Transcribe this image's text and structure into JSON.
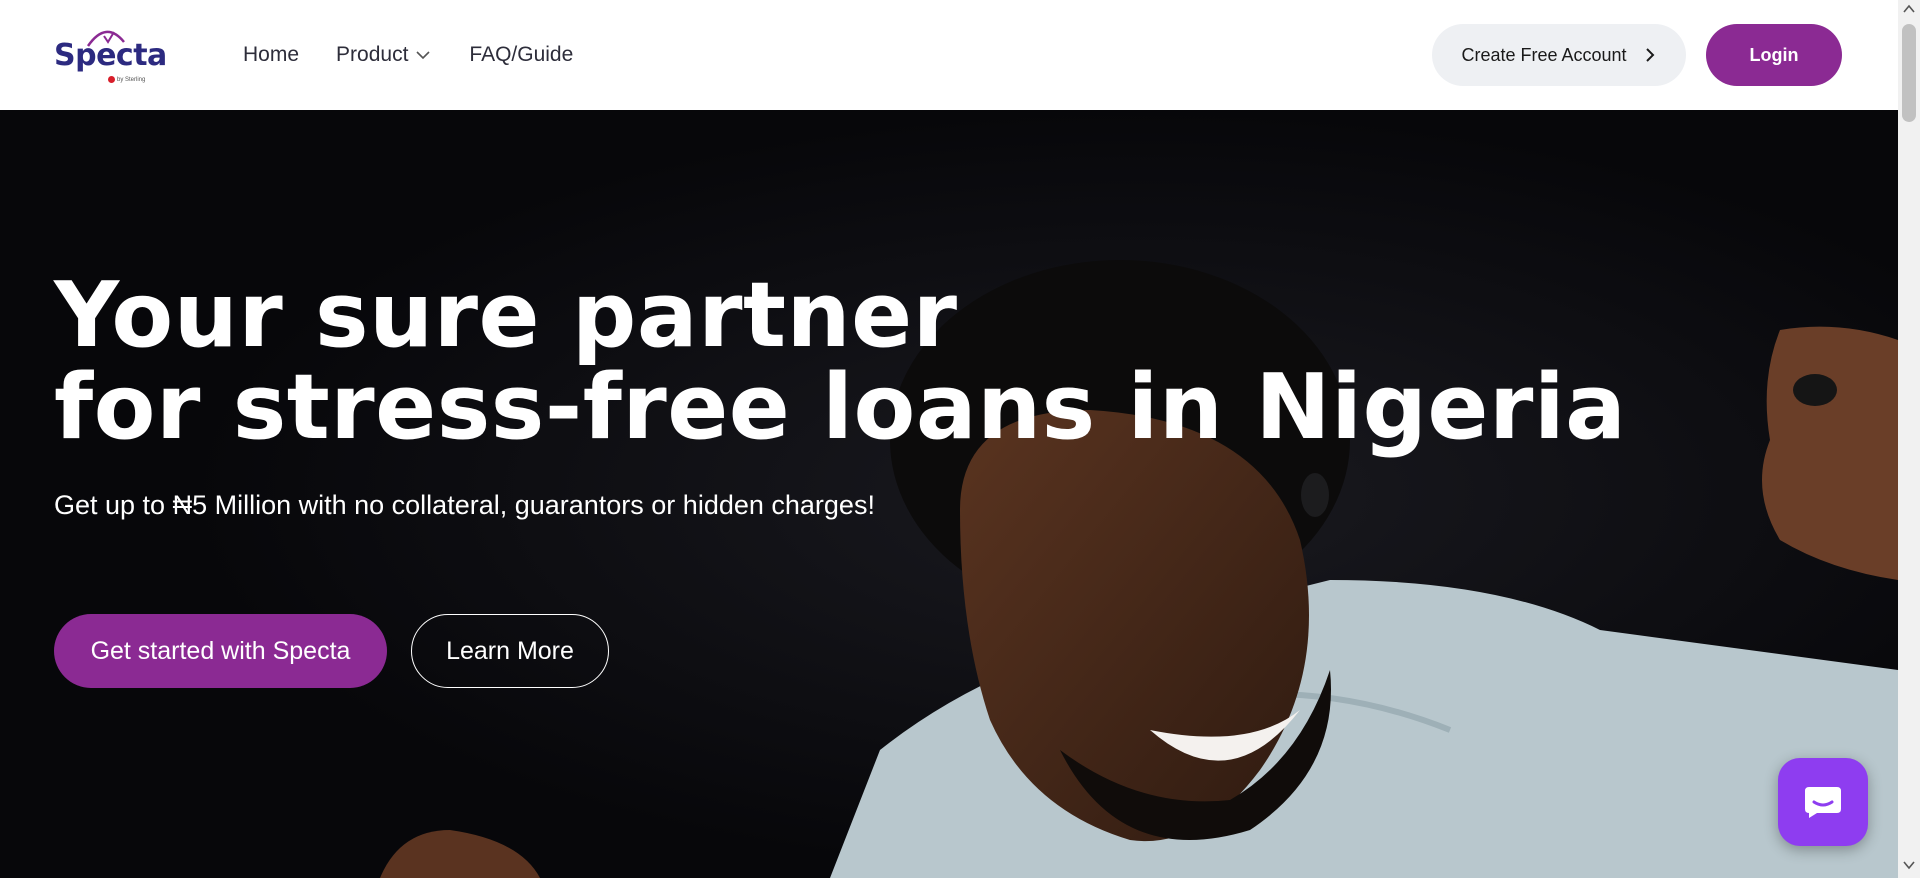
{
  "brand": {
    "logo_text": "Specta",
    "logo_tagline": "by Sterling",
    "accent": "#8b2a93",
    "logo_color": "#2c2a80"
  },
  "nav": {
    "items": [
      {
        "label": "Home"
      },
      {
        "label": "Product",
        "icon": "chevron-down-icon"
      },
      {
        "label": "FAQ/Guide"
      }
    ]
  },
  "header": {
    "create_account_label": "Create Free Account",
    "create_account_icon": "chevron-right-icon",
    "login_label": "Login"
  },
  "hero": {
    "title_line1": "Your sure partner",
    "title_line2": "for stress-free loans in Nigeria",
    "subtitle": "Get up to ₦5 Million with no collateral, guarantors or hidden charges!",
    "primary_cta": "Get started with Specta",
    "secondary_cta": "Learn More",
    "background": "#07070a"
  },
  "chat": {
    "icon": "chat-bubble-icon",
    "color": "#8e3df0"
  }
}
